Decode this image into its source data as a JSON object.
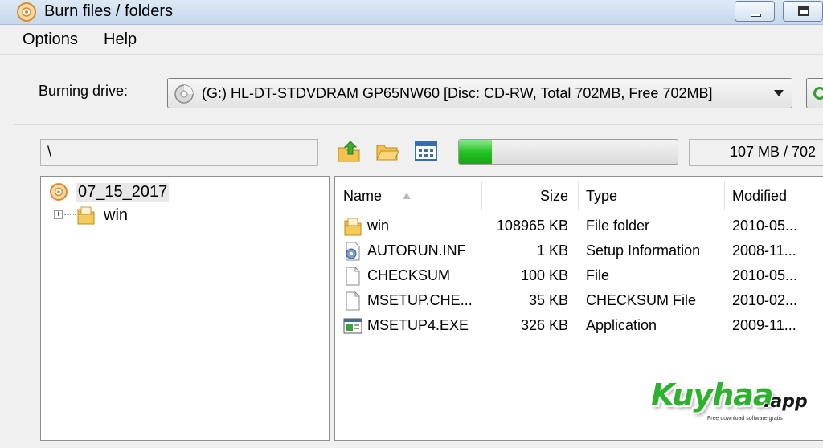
{
  "window": {
    "title": "Burn files / folders"
  },
  "menu": {
    "options": "Options",
    "help": "Help"
  },
  "drive": {
    "label": "Burning drive:",
    "selected": "(G:) HL-DT-STDVDRAM GP65NW60 [Disc: CD-RW, Total 702MB, Free 702MB]"
  },
  "path": {
    "value": "\\"
  },
  "progress": {
    "fraction": 0.15,
    "readout": "107 MB / 702"
  },
  "tree": {
    "root": "07_15_2017",
    "children": [
      {
        "label": "win"
      }
    ]
  },
  "list": {
    "columns": {
      "name": "Name",
      "size": "Size",
      "type": "Type",
      "modified": "Modified"
    },
    "rows": [
      {
        "name": "win",
        "size": "108965 KB",
        "type": "File folder",
        "modified": "2010-05...",
        "icon": "folder-icon"
      },
      {
        "name": "AUTORUN.INF",
        "size": "1 KB",
        "type": "Setup Information",
        "modified": "2008-11...",
        "icon": "settings-file-icon"
      },
      {
        "name": "CHECKSUM",
        "size": "100 KB",
        "type": "File",
        "modified": "2010-05...",
        "icon": "file-icon"
      },
      {
        "name": "MSETUP.CHE...",
        "size": "35 KB",
        "type": "CHECKSUM File",
        "modified": "2010-02...",
        "icon": "file-icon"
      },
      {
        "name": "MSETUP4.EXE",
        "size": "326 KB",
        "type": "Application",
        "modified": "2009-11...",
        "icon": "application-icon"
      }
    ]
  },
  "watermark": {
    "brand": "Kuyhaa",
    "suffix": ".app",
    "tagline": "Free download software gratis"
  },
  "colors": {
    "progress_green": "#1fbf1f",
    "titlebar": "#c6d8ee"
  }
}
